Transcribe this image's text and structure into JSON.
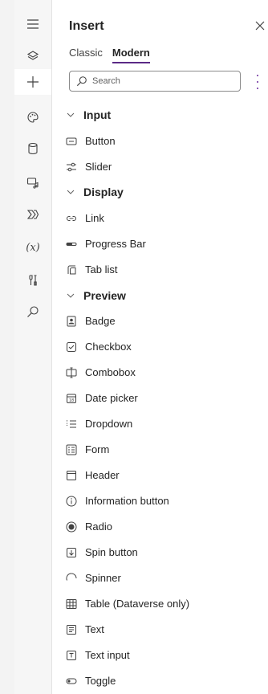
{
  "panel": {
    "title": "Insert",
    "tabs": [
      {
        "label": "Classic",
        "selected": false
      },
      {
        "label": "Modern",
        "selected": true
      }
    ],
    "search": {
      "placeholder": "Search"
    }
  },
  "rail": {
    "items": [
      {
        "icon": "hamburger-menu-icon"
      },
      {
        "icon": "layers-icon"
      },
      {
        "icon": "add-icon",
        "active": true
      },
      {
        "icon": "palette-icon"
      },
      {
        "icon": "database-icon"
      },
      {
        "icon": "media-icon"
      },
      {
        "icon": "flow-icon"
      },
      {
        "icon": "variables-icon",
        "text": "(x)"
      },
      {
        "icon": "tools-icon"
      },
      {
        "icon": "search-icon"
      }
    ]
  },
  "categories": [
    {
      "label": "Input",
      "items": [
        {
          "label": "Button",
          "icon": "button-icon"
        },
        {
          "label": "Slider",
          "icon": "slider-icon"
        }
      ]
    },
    {
      "label": "Display",
      "items": [
        {
          "label": "Link",
          "icon": "link-icon"
        },
        {
          "label": "Progress Bar",
          "icon": "progress-bar-icon"
        },
        {
          "label": "Tab list",
          "icon": "tab-list-icon"
        }
      ]
    },
    {
      "label": "Preview",
      "items": [
        {
          "label": "Badge",
          "icon": "badge-icon"
        },
        {
          "label": "Checkbox",
          "icon": "checkbox-icon"
        },
        {
          "label": "Combobox",
          "icon": "combobox-icon"
        },
        {
          "label": "Date picker",
          "icon": "date-picker-icon"
        },
        {
          "label": "Dropdown",
          "icon": "dropdown-icon"
        },
        {
          "label": "Form",
          "icon": "form-icon"
        },
        {
          "label": "Header",
          "icon": "header-icon"
        },
        {
          "label": "Information button",
          "icon": "information-icon"
        },
        {
          "label": "Radio",
          "icon": "radio-icon"
        },
        {
          "label": "Spin button",
          "icon": "spin-button-icon"
        },
        {
          "label": "Spinner",
          "icon": "spinner-icon"
        },
        {
          "label": "Table (Dataverse only)",
          "icon": "table-icon"
        },
        {
          "label": "Text",
          "icon": "text-icon"
        },
        {
          "label": "Text input",
          "icon": "text-input-icon"
        },
        {
          "label": "Toggle",
          "icon": "toggle-icon"
        }
      ]
    }
  ],
  "colors": {
    "accent": "#5b2a86",
    "rail_bg": "#f6f6f6",
    "text": "#242424"
  }
}
